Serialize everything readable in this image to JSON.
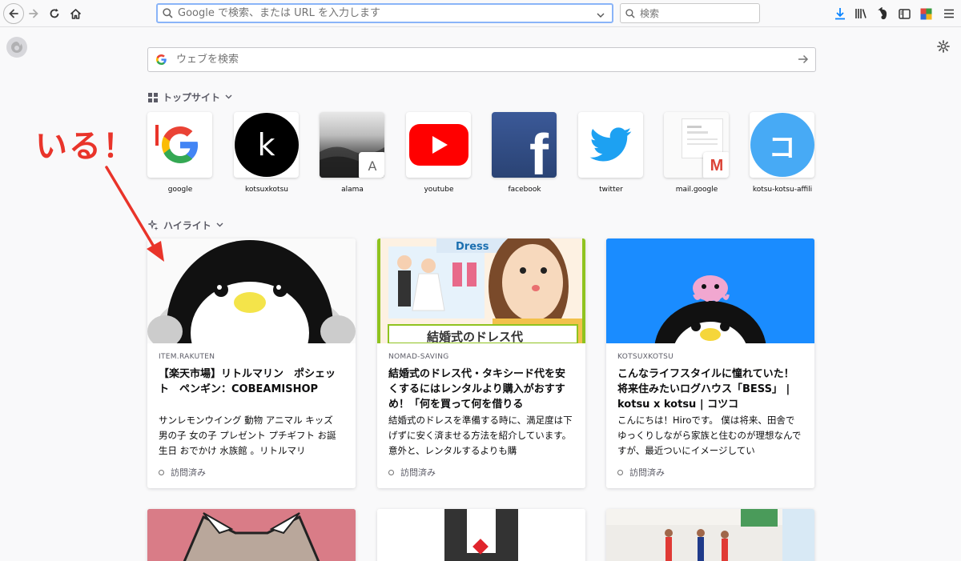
{
  "toolbar": {
    "url_placeholder": "Google で検索、または URL を入力します",
    "search_placeholder": "検索"
  },
  "newtab": {
    "search_placeholder": "ウェブを検索",
    "topsites_title": "トップサイト",
    "highlights_title": "ハイライト",
    "topsites": [
      {
        "label": "google",
        "icon": "google-g-icon"
      },
      {
        "label": "kotsuxkotsu",
        "letter": "k"
      },
      {
        "label": "alama",
        "letter": "A"
      },
      {
        "label": "youtube",
        "icon": "youtube-play-icon"
      },
      {
        "label": "facebook",
        "letter": "f"
      },
      {
        "label": "twitter",
        "icon": "twitter-bird-icon"
      },
      {
        "label": "mail.google",
        "letter": "M"
      },
      {
        "label": "kotsu-kotsu-affili",
        "letter": "コ"
      }
    ],
    "highlights": [
      {
        "source": "ITEM.RAKUTEN",
        "title": "【楽天市場】リトルマリン　ポシェット　ペンギン：COBEAMISHOP",
        "description": "サンレモンウイング 動物 アニマル キッズ 男の子 女の子 プレゼント プチギフト お誕生日 おでかけ 水族館 。リトルマリ",
        "visited": "訪問済み"
      },
      {
        "source": "NOMAD-SAVING",
        "title": "結婚式のドレス代・タキシード代を安くするにはレンタルより購入がおすすめ！「何を買って何を借りる",
        "description": "結婚式のドレスを準備する時に、満足度は下げずに安く済ませる方法を紹介しています。意外と、レンタルするよりも購",
        "visited": "訪問済み",
        "image_text": {
          "dress": "Dress",
          "banner": "結婚式のドレス代"
        }
      },
      {
        "source": "KOTSUXKOTSU",
        "title": "こんなライフスタイルに憧れていた！将来住みたいログハウス「BESS」 | kotsu x kotsu | コツコ",
        "description": "こんにちは！Hiroです。 僕は将来、田舎でゆっくりしながら家族と住むのが理想なんですが、最近ついにイメージしてい",
        "visited": "訪問済み"
      }
    ]
  },
  "annotation": {
    "text": "いる！",
    "color": "#e9342a"
  },
  "colors": {
    "accent": "#0a84ff",
    "annotation_red": "#e9342a",
    "youtube_red": "#ff0000",
    "facebook_blue": "#3b5998",
    "twitter_blue": "#1da1f2",
    "kotsu_blue": "#47aaf5"
  }
}
